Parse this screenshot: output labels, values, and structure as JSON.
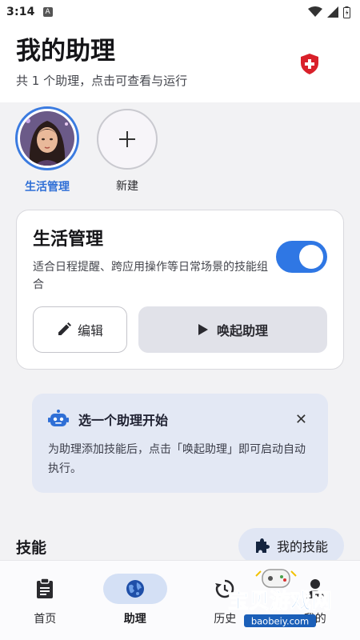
{
  "status_bar": {
    "time": "3:14",
    "app_indicator": "A"
  },
  "header": {
    "title": "我的助理",
    "subtitle": "共 1 个助理，点击可查看与运行",
    "shield_icon": "shield-icon",
    "shield_color": "#d9202a"
  },
  "assistants": [
    {
      "label": "生活管理",
      "selected": true
    },
    {
      "label": "新建",
      "icon": "plus-icon"
    }
  ],
  "card": {
    "title": "生活管理",
    "description": "适合日程提醒、跨应用操作等日常场景的技能组合",
    "toggle_on": true,
    "edit_label": "编辑",
    "invoke_label": "唤起助理",
    "accent": "#2f77e4"
  },
  "tip": {
    "title": "选一个助理开始",
    "body": "为助理添加技能后，点击「唤起助理」即可启动自动执行。",
    "close_icon": "close-icon"
  },
  "skills": {
    "label": "技能",
    "my_skills_label": "我的技能"
  },
  "nav": [
    {
      "label": "首页",
      "icon": "clipboard-icon"
    },
    {
      "label": "助理",
      "icon": "globe-icon",
      "active": true
    },
    {
      "label": "历史",
      "icon": "history-icon"
    },
    {
      "label": "我的",
      "icon": "person-icon"
    }
  ],
  "watermark": {
    "title": "宝贝游戏网",
    "url": "baobeiy.com"
  }
}
